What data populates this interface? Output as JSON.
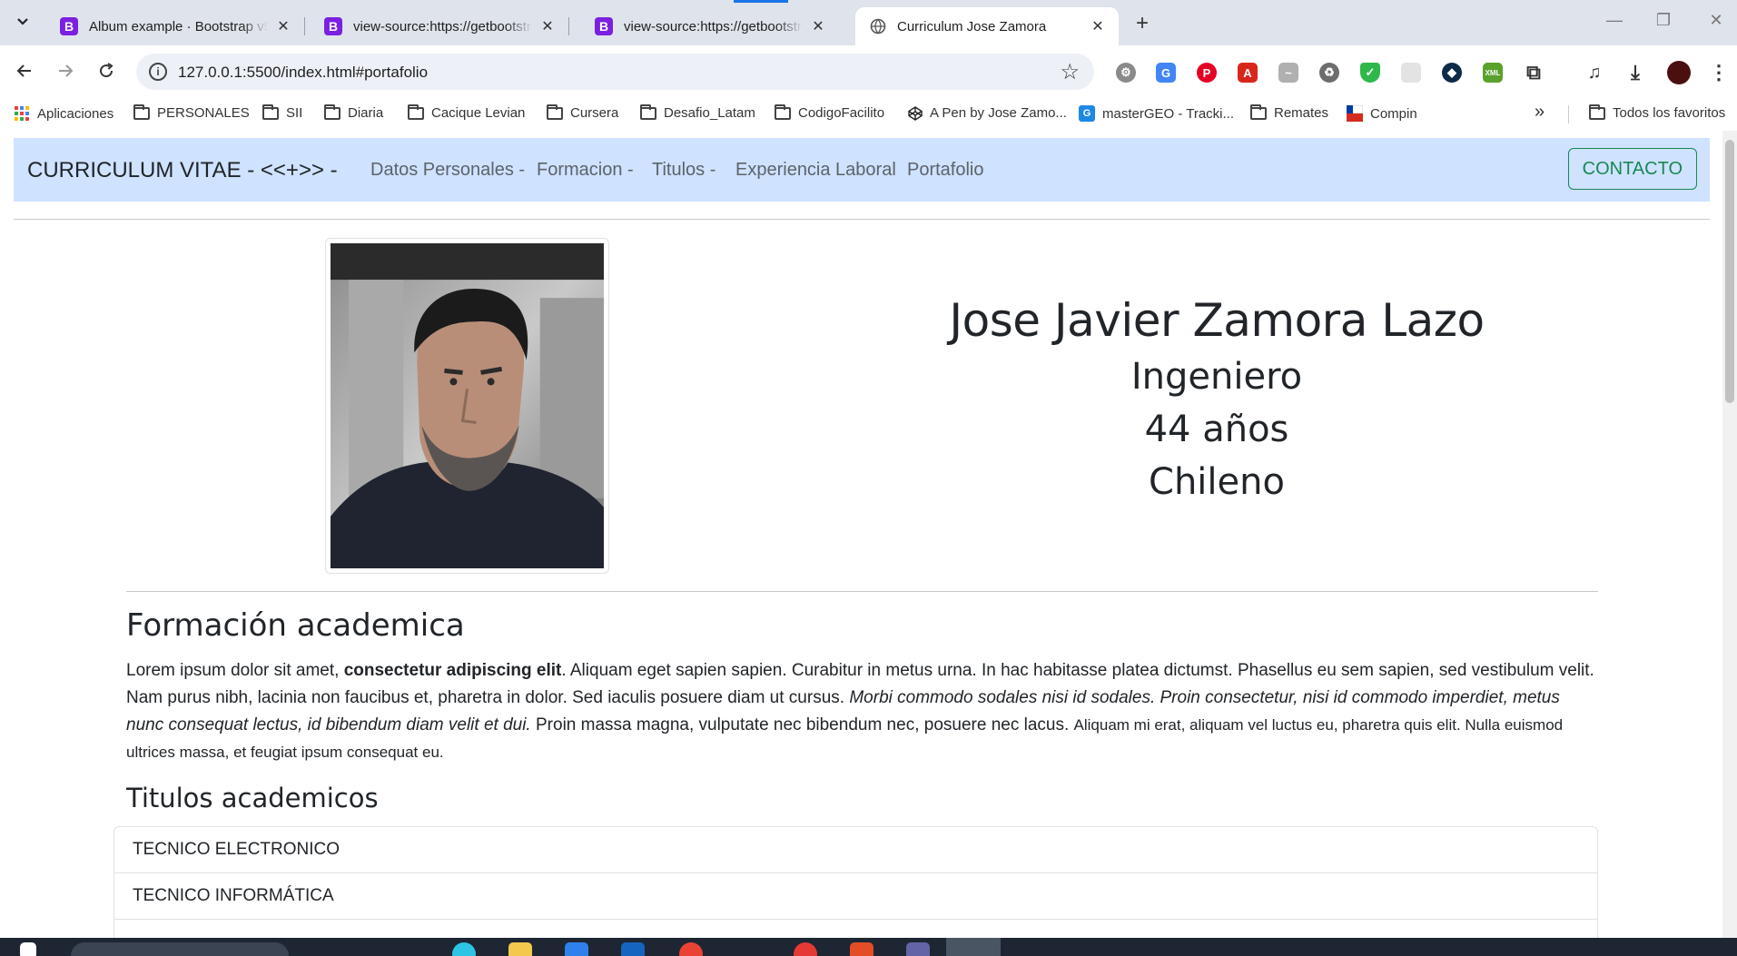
{
  "browser": {
    "tabs": [
      {
        "title": "Album example · Bootstrap v5.3",
        "favicon": "B"
      },
      {
        "title": "view-source:https://getbootstrap.com",
        "favicon": "B"
      },
      {
        "title": "view-source:https://getbootstrap.com",
        "favicon": "B"
      },
      {
        "title": "Curriculum Jose Zamora",
        "favicon": "globe-icon"
      }
    ],
    "url": "127.0.0.1:5500/index.html#portafolio",
    "bookmarks": [
      {
        "label": "Aplicaciones",
        "icon": "apps-grid-icon"
      },
      {
        "label": "PERSONALES",
        "icon": "folder-icon"
      },
      {
        "label": "SII",
        "icon": "folder-icon"
      },
      {
        "label": "Diaria",
        "icon": "folder-icon"
      },
      {
        "label": "Cacique Levian",
        "icon": "folder-icon"
      },
      {
        "label": "Cursera",
        "icon": "folder-icon"
      },
      {
        "label": "Desafio_Latam",
        "icon": "folder-icon"
      },
      {
        "label": "CodigoFacilito",
        "icon": "folder-icon"
      },
      {
        "label": "A Pen by Jose Zamo...",
        "icon": "codepen-icon"
      },
      {
        "label": "masterGEO - Tracki...",
        "icon": "geo-icon"
      },
      {
        "label": "Remates",
        "icon": "folder-icon"
      },
      {
        "label": "Compin",
        "icon": "flag-icon"
      }
    ],
    "more_bookmarks": "»",
    "all_bookmarks": "Todos los favoritos"
  },
  "site": {
    "brand": "CURRICULUM VITAE - <<+>> -",
    "nav": [
      "Datos Personales -",
      "Formacion -",
      "Titulos -",
      "Experiencia Laboral",
      "Portafolio"
    ],
    "contact_button": "CONTACTO"
  },
  "profile": {
    "name": "Jose Javier Zamora Lazo",
    "profession": "Ingeniero",
    "age": "44 años",
    "nationality": "Chileno"
  },
  "formacion": {
    "heading": "Formación academica",
    "p1": "Lorem ipsum dolor sit amet, ",
    "bold": "consectetur adipiscing elit",
    "p2": ". Aliquam eget sapien sapien. Curabitur in metus urna. In hac habitasse platea dictumst. Phasellus eu sem sapien, sed vestibulum velit. Nam purus nibh, lacinia non faucibus et, pharetra in dolor. Sed iaculis posuere diam ut cursus. ",
    "italic": "Morbi commodo sodales nisi id sodales. Proin consectetur, nisi id commodo imperdiet, metus nunc consequat lectus, id bibendum diam velit et dui.",
    "p3": " Proin massa magna, vulputate nec bibendum nec, posuere nec lacus. ",
    "small": "Aliquam mi erat, aliquam vel luctus eu, pharetra quis elit. Nulla euismod ultrices massa, et feugiat ipsum consequat eu."
  },
  "titulos": {
    "heading": "Titulos academicos",
    "items": [
      "TECNICO ELECTRONICO",
      "TECNICO INFORMÁTICA"
    ]
  },
  "colors": {
    "navbar_bg": "#cfe2ff",
    "contact_accent": "#198754",
    "tab_favicon": "#7b1fe0"
  }
}
